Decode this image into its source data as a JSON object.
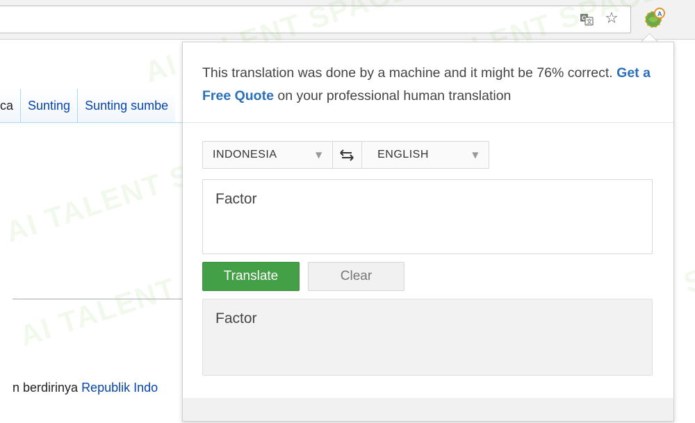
{
  "browser": {
    "omnibox_value": "",
    "translate_icon": "translate-icon",
    "star_icon": "star-icon",
    "extension_icon": "translator-extension-icon"
  },
  "page": {
    "tabs": [
      {
        "label": "ca"
      },
      {
        "label": "Sunting"
      },
      {
        "label": "Sunting sumbe"
      }
    ],
    "body_text_prefix": "n berdirinya ",
    "body_link": "Republik Indo"
  },
  "watermark": "AI TALENT SPACE",
  "popup": {
    "notice_part1": "This translation was done by a machine and it might be 76% correct.",
    "notice_link": "Get a Free Quote",
    "notice_part2": "on your professional human translation",
    "source_language": "INDONESIA",
    "target_language": "ENGLISH",
    "source_text": "Factor",
    "translate_label": "Translate",
    "clear_label": "Clear",
    "result_text": "Factor"
  },
  "colors": {
    "accent_green": "#43a047",
    "link_blue": "#2a6fb8",
    "wiki_link": "#0645ad"
  }
}
